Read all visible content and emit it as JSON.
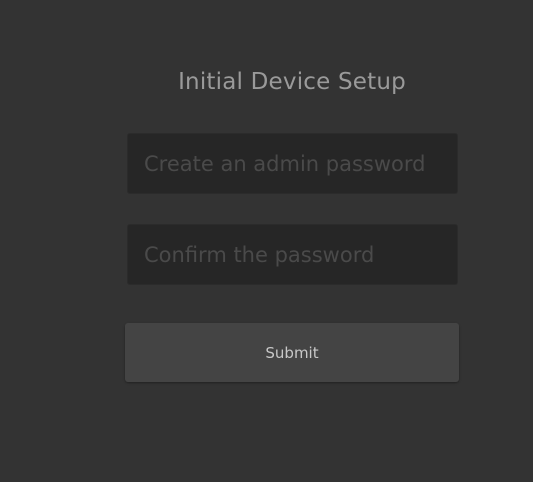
{
  "setup": {
    "title": "Initial Device Setup",
    "password_placeholder": "Create an admin password",
    "confirm_placeholder": "Confirm the password",
    "submit_label": "Submit"
  },
  "colors": {
    "background": "#333333",
    "input_background": "#262626",
    "button_background": "#444444",
    "title_text": "#9a9a9a",
    "placeholder_text": "#4a4a4a"
  }
}
